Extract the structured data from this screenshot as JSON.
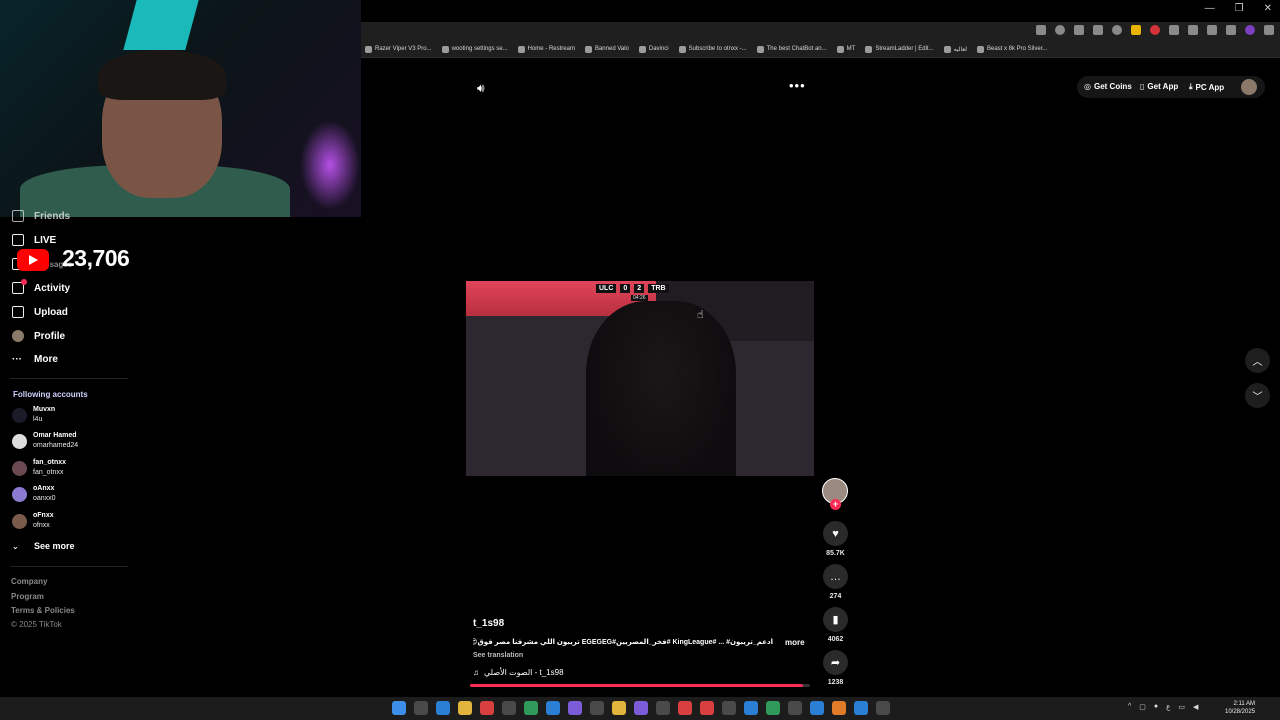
{
  "window": {
    "controls": [
      "—",
      "❐",
      "✕"
    ]
  },
  "bookmarks": [
    "Razer Viper V3 Pro...",
    "wooting settings se...",
    "Home - Restream",
    "Banned Valo",
    "Davinci",
    "Subscribe to otnxx -...",
    "The best ChatBot an...",
    "MT",
    "StreamLadder | Edit...",
    "لعاليه",
    "Beast x 8k Pro Silver..."
  ],
  "youtube_overlay": {
    "count": "23,706"
  },
  "sidebar": {
    "items": [
      {
        "label": "Friends",
        "icon": "friends-icon"
      },
      {
        "label": "LIVE",
        "icon": "live-icon"
      },
      {
        "label": "Messages",
        "icon": "messages-icon"
      },
      {
        "label": "Activity",
        "icon": "activity-icon"
      },
      {
        "label": "Upload",
        "icon": "upload-icon"
      },
      {
        "label": "Profile",
        "icon": "profile-icon"
      },
      {
        "label": "More",
        "icon": "more-icon"
      }
    ],
    "following_title": "Following accounts",
    "accounts": [
      {
        "name": "Muvxn",
        "handle": "l4u"
      },
      {
        "name": "Omar Hamed",
        "handle": "omarhamed24"
      },
      {
        "name": "fan_otnxx",
        "handle": "fan_otnxx"
      },
      {
        "name": "oAnxx",
        "handle": "oanxx0"
      },
      {
        "name": "oFnxx",
        "handle": "ofnxx"
      }
    ],
    "see_more": "See more",
    "footer": [
      "Company",
      "Program",
      "Terms & Policies",
      "© 2025 TikTok"
    ]
  },
  "header": {
    "get_coins": "Get Coins",
    "get_app": "Get App",
    "pc_app": "PC App"
  },
  "video": {
    "score_left_team": "ULC",
    "score_left": "0",
    "score_right": "2",
    "score_right_team": "TRB",
    "time": "04:26"
  },
  "actions": {
    "likes": "85.7K",
    "comments": "274",
    "saves": "4062",
    "shares": "1238"
  },
  "post": {
    "username": "t_1s98",
    "caption": "ادعم_تريبون# ... #KingLeague #فخر_المصريين#EGEGEG تريبون اللي مشرفنا مصر فوق😍EGEGEG",
    "more": "more",
    "see_translation": "See translation",
    "music": "الصوت الأصلي - t_1s98",
    "progress_percent": 98
  },
  "taskbar": {
    "time": "2:11 AM",
    "date": "10/28/2025",
    "lang": "ع"
  },
  "colors": {
    "accent": "#fe2c55",
    "background": "#000000"
  }
}
